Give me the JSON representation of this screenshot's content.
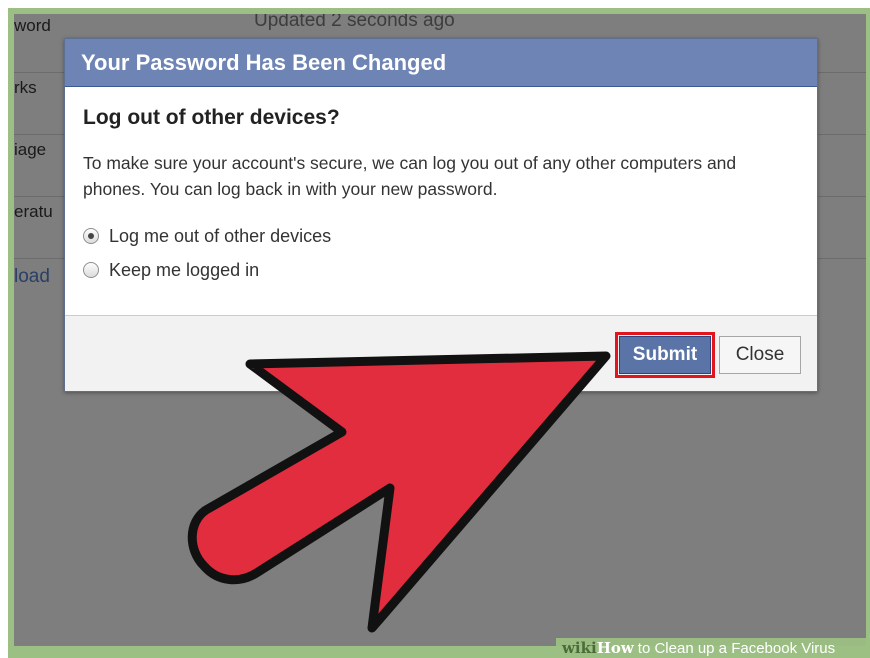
{
  "background_settings": {
    "rows": [
      {
        "label": "word",
        "value": "Updated 2 seconds ago"
      },
      {
        "label": "rks",
        "value": ""
      },
      {
        "label": "iage",
        "value": ""
      },
      {
        "label": "eratu",
        "value": ""
      }
    ],
    "link": "load"
  },
  "dialog": {
    "title": "Your Password Has Been Changed",
    "subheading": "Log out of other devices?",
    "description": "To make sure your account's secure, we can log you out of any other computers and phones. You can log back in with your new password.",
    "options": [
      {
        "label": "Log me out of other devices",
        "selected": true
      },
      {
        "label": "Keep me logged in",
        "selected": false
      }
    ],
    "submit_label": "Submit",
    "close_label": "Close"
  },
  "annotation": {
    "highlight_color": "#e0151e",
    "arrow_color": "#e22d3f"
  },
  "watermark": {
    "wiki": "wiki",
    "how": "How",
    "text": "to Clean up a Facebook Virus"
  }
}
